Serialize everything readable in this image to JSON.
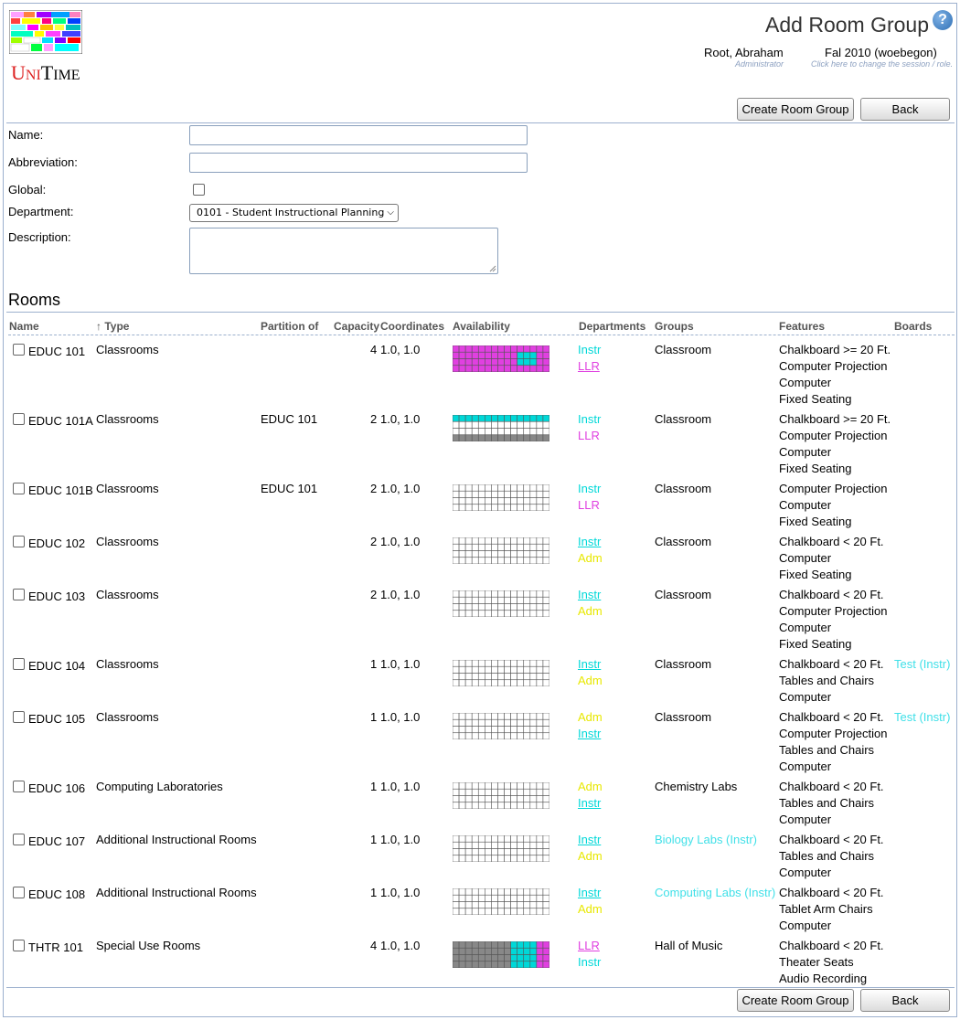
{
  "header": {
    "app_name": "UniTime",
    "title": "Add Room Group",
    "user_name": "Root, Abraham",
    "user_role": "Administrator",
    "session_name": "Fal 2010 (woebegon)",
    "session_hint": "Click here to change the session / role."
  },
  "buttons": {
    "create_label": "Create Room Group",
    "back_label": "Back"
  },
  "form": {
    "name_label": "Name:",
    "name_value": "",
    "abbreviation_label": "Abbreviation:",
    "abbreviation_value": "",
    "global_label": "Global:",
    "global_checked": false,
    "department_label": "Department:",
    "department_value": "0101 - Student Instructional Planning",
    "description_label": "Description:",
    "description_value": ""
  },
  "rooms": {
    "section_title": "Rooms",
    "columns": [
      "Name",
      "↑ Type",
      "Partition of",
      "Capacity",
      "Coordinates",
      "Availability",
      "Departments",
      "Groups",
      "Features",
      "Boards"
    ],
    "colors": {
      "instr": "#00d8d8",
      "llr": "#e040e0",
      "adm": "#e8e800",
      "unavail": "#888888",
      "free": "#ffffff"
    },
    "rows": [
      {
        "name": "EDUC 101",
        "type": "Classrooms",
        "partition": "",
        "capacity": "4",
        "coordinates": "1.0, 1.0",
        "availability": "magenta-cyan",
        "departments": [
          {
            "text": "Instr",
            "color": "instr",
            "link": false
          },
          {
            "text": "LLR",
            "color": "llr",
            "link": true
          }
        ],
        "groups": [
          {
            "text": "Classroom",
            "color": ""
          }
        ],
        "features": [
          "Chalkboard >= 20 Ft.",
          "Computer Projection",
          "Computer",
          "Fixed Seating"
        ],
        "boards": ""
      },
      {
        "name": "EDUC 101A",
        "type": "Classrooms",
        "partition": "EDUC 101",
        "capacity": "2",
        "coordinates": "1.0, 1.0",
        "availability": "cyan-top-grey-bottom",
        "departments": [
          {
            "text": "Instr",
            "color": "instr",
            "link": false
          },
          {
            "text": "LLR",
            "color": "llr",
            "link": false
          }
        ],
        "groups": [
          {
            "text": "Classroom",
            "color": ""
          }
        ],
        "features": [
          "Chalkboard >= 20 Ft.",
          "Computer Projection",
          "Computer",
          "Fixed Seating"
        ],
        "boards": ""
      },
      {
        "name": "EDUC 101B",
        "type": "Classrooms",
        "partition": "EDUC 101",
        "capacity": "2",
        "coordinates": "1.0, 1.0",
        "availability": "empty",
        "departments": [
          {
            "text": "Instr",
            "color": "instr",
            "link": false
          },
          {
            "text": "LLR",
            "color": "llr",
            "link": false
          }
        ],
        "groups": [
          {
            "text": "Classroom",
            "color": ""
          }
        ],
        "features": [
          "Computer Projection",
          "Computer",
          "Fixed Seating"
        ],
        "boards": ""
      },
      {
        "name": "EDUC 102",
        "type": "Classrooms",
        "partition": "",
        "capacity": "2",
        "coordinates": "1.0, 1.0",
        "availability": "empty",
        "departments": [
          {
            "text": "Instr",
            "color": "instr",
            "link": true
          },
          {
            "text": "Adm",
            "color": "adm",
            "link": false
          }
        ],
        "groups": [
          {
            "text": "Classroom",
            "color": ""
          }
        ],
        "features": [
          "Chalkboard < 20 Ft.",
          "Computer",
          "Fixed Seating"
        ],
        "boards": ""
      },
      {
        "name": "EDUC 103",
        "type": "Classrooms",
        "partition": "",
        "capacity": "2",
        "coordinates": "1.0, 1.0",
        "availability": "empty",
        "departments": [
          {
            "text": "Instr",
            "color": "instr",
            "link": true
          },
          {
            "text": "Adm",
            "color": "adm",
            "link": false
          }
        ],
        "groups": [
          {
            "text": "Classroom",
            "color": ""
          }
        ],
        "features": [
          "Chalkboard < 20 Ft.",
          "Computer Projection",
          "Computer",
          "Fixed Seating"
        ],
        "boards": ""
      },
      {
        "name": "EDUC 104",
        "type": "Classrooms",
        "partition": "",
        "capacity": "1",
        "coordinates": "1.0, 1.0",
        "availability": "empty",
        "departments": [
          {
            "text": "Instr",
            "color": "instr",
            "link": true
          },
          {
            "text": "Adm",
            "color": "adm",
            "link": false
          }
        ],
        "groups": [
          {
            "text": "Classroom",
            "color": ""
          }
        ],
        "features": [
          "Chalkboard < 20 Ft.",
          "Tables and Chairs",
          "Computer"
        ],
        "boards": "Test (Instr)"
      },
      {
        "name": "EDUC 105",
        "type": "Classrooms",
        "partition": "",
        "capacity": "1",
        "coordinates": "1.0, 1.0",
        "availability": "empty",
        "departments": [
          {
            "text": "Adm",
            "color": "adm",
            "link": false
          },
          {
            "text": "Instr",
            "color": "instr",
            "link": true
          }
        ],
        "groups": [
          {
            "text": "Classroom",
            "color": ""
          }
        ],
        "features": [
          "Chalkboard < 20 Ft.",
          "Computer Projection",
          "Tables and Chairs",
          "Computer"
        ],
        "boards": "Test (Instr)"
      },
      {
        "name": "EDUC 106",
        "type": "Computing Laboratories",
        "partition": "",
        "capacity": "1",
        "coordinates": "1.0, 1.0",
        "availability": "empty",
        "departments": [
          {
            "text": "Adm",
            "color": "adm",
            "link": false
          },
          {
            "text": "Instr",
            "color": "instr",
            "link": true
          }
        ],
        "groups": [
          {
            "text": "Chemistry Labs",
            "color": ""
          }
        ],
        "features": [
          "Chalkboard < 20 Ft.",
          "Tables and Chairs",
          "Computer"
        ],
        "boards": ""
      },
      {
        "name": "EDUC 107",
        "type": "Additional Instructional Rooms",
        "partition": "",
        "capacity": "1",
        "coordinates": "1.0, 1.0",
        "availability": "empty",
        "departments": [
          {
            "text": "Instr",
            "color": "instr",
            "link": true
          },
          {
            "text": "Adm",
            "color": "adm",
            "link": false
          }
        ],
        "groups": [
          {
            "text": "Biology Labs (Instr)",
            "color": "grp"
          }
        ],
        "features": [
          "Chalkboard < 20 Ft.",
          "Tables and Chairs",
          "Computer"
        ],
        "boards": ""
      },
      {
        "name": "EDUC 108",
        "type": "Additional Instructional Rooms",
        "partition": "",
        "capacity": "1",
        "coordinates": "1.0, 1.0",
        "availability": "empty",
        "departments": [
          {
            "text": "Instr",
            "color": "instr",
            "link": true
          },
          {
            "text": "Adm",
            "color": "adm",
            "link": false
          }
        ],
        "groups": [
          {
            "text": "Computing Labs (Instr)",
            "color": "grp"
          }
        ],
        "features": [
          "Chalkboard < 20 Ft.",
          "Tablet Arm Chairs",
          "Computer"
        ],
        "boards": ""
      },
      {
        "name": "THTR 101",
        "type": "Special Use Rooms",
        "partition": "",
        "capacity": "4",
        "coordinates": "1.0, 1.0",
        "availability": "grey-cyan-magenta",
        "departments": [
          {
            "text": "LLR",
            "color": "llr",
            "link": true
          },
          {
            "text": "Instr",
            "color": "instr",
            "link": false
          }
        ],
        "groups": [
          {
            "text": "Hall of Music",
            "color": ""
          }
        ],
        "features": [
          "Chalkboard < 20 Ft.",
          "Theater Seats",
          "Audio Recording"
        ],
        "boards": ""
      }
    ]
  }
}
